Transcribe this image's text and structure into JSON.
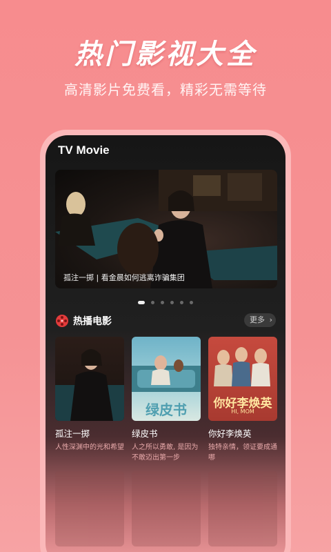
{
  "promo": {
    "headline": "热门影视大全",
    "subline": "高清影片免费看，精彩无需等待"
  },
  "app": {
    "title": "TV Movie"
  },
  "banner": {
    "caption": "孤注一掷 | 看金晨如何逃离诈骗集团",
    "slide_count": 6,
    "active_index": 0
  },
  "section": {
    "title": "热播电影",
    "more_label": "更多",
    "icon": "film-reel-icon"
  },
  "movies": [
    {
      "title": "孤注一掷",
      "desc": "人性深渊中的光和希望"
    },
    {
      "title": "绿皮书",
      "desc": "人之所以勇敢, 是因为不敢迈出第一步"
    },
    {
      "title": "你好李焕英",
      "desc": "独特亲情，领证要成通哪"
    }
  ],
  "poster_text": {
    "green_book": "绿皮书",
    "li_huanying": "你好李焕英",
    "li_huanying_en": "HI, MOM"
  },
  "colors": {
    "page_bg": "#f78c8e",
    "screen_bg": "#161616",
    "accent": "#e23b3b"
  }
}
